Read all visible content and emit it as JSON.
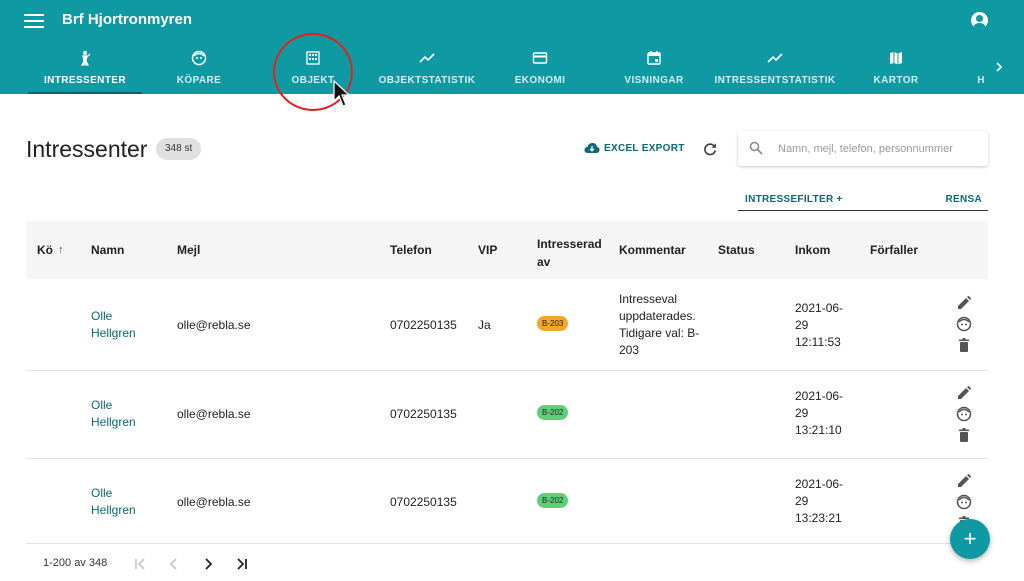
{
  "app": {
    "title": "Brf Hjortronmyren"
  },
  "tabs": [
    {
      "label": "INTRESSENTER",
      "icon": "person-pin-icon",
      "active": true
    },
    {
      "label": "KÖPARE",
      "icon": "face-icon"
    },
    {
      "label": "OBJEKT",
      "icon": "apartment-icon"
    },
    {
      "label": "OBJEKTSTATISTIK",
      "icon": "trending-up-icon"
    },
    {
      "label": "EKONOMI",
      "icon": "credit-card-icon"
    },
    {
      "label": "VISNINGAR",
      "icon": "event-icon"
    },
    {
      "label": "INTRESSENTSTATISTIK",
      "icon": "trending-up-icon"
    },
    {
      "label": "KARTOR",
      "icon": "map-icon"
    },
    {
      "label": "H",
      "icon": "more-icon"
    }
  ],
  "page": {
    "title": "Intressenter",
    "count": "348 st",
    "excel_export": "EXCEL EXPORT",
    "search_placeholder": "Namn, mejl, telefon, personnummer",
    "filter_add": "INTRESSEFILTER +",
    "filter_clear": "RENSA"
  },
  "table": {
    "columns": {
      "queue": "Kö",
      "name": "Namn",
      "email": "Mejl",
      "phone": "Telefon",
      "vip": "VIP",
      "interested_1": "Intresserad",
      "interested_2": "av",
      "comment": "Kommentar",
      "status": "Status",
      "incoming": "Inkom",
      "expires": "Förfaller"
    },
    "rows": [
      {
        "name_1": "Olle",
        "name_2": "Hellgren",
        "email": "olle@rebla.se",
        "phone": "0702250135",
        "vip": "Ja",
        "object": "B-203",
        "object_color": "#f5a623",
        "comment_lines": [
          "Intresseval",
          "uppdaterades.",
          "Tidigare val: B-",
          "203"
        ],
        "status": "",
        "date_1": "2021-06-",
        "date_2": "29",
        "time": "12:11:53",
        "expires": ""
      },
      {
        "name_1": "Olle",
        "name_2": "Hellgren",
        "email": "olle@rebla.se",
        "phone": "0702250135",
        "vip": "",
        "object": "B-202",
        "object_color": "#5fd07a",
        "comment_lines": [],
        "status": "",
        "date_1": "2021-06-",
        "date_2": "29",
        "time": "13:21:10",
        "expires": ""
      },
      {
        "name_1": "Olle",
        "name_2": "Hellgren",
        "email": "olle@rebla.se",
        "phone": "0702250135",
        "vip": "",
        "object": "B-202",
        "object_color": "#5fd07a",
        "comment_lines": [],
        "status": "",
        "date_1": "2021-06-",
        "date_2": "29",
        "time": "13:23:21",
        "expires": ""
      }
    ]
  },
  "pagination": {
    "range": "1-200 av 348"
  },
  "colors": {
    "primary": "#0f9aa3",
    "accent_text": "#0b6a73",
    "highlight_circle": "#e0221b"
  }
}
